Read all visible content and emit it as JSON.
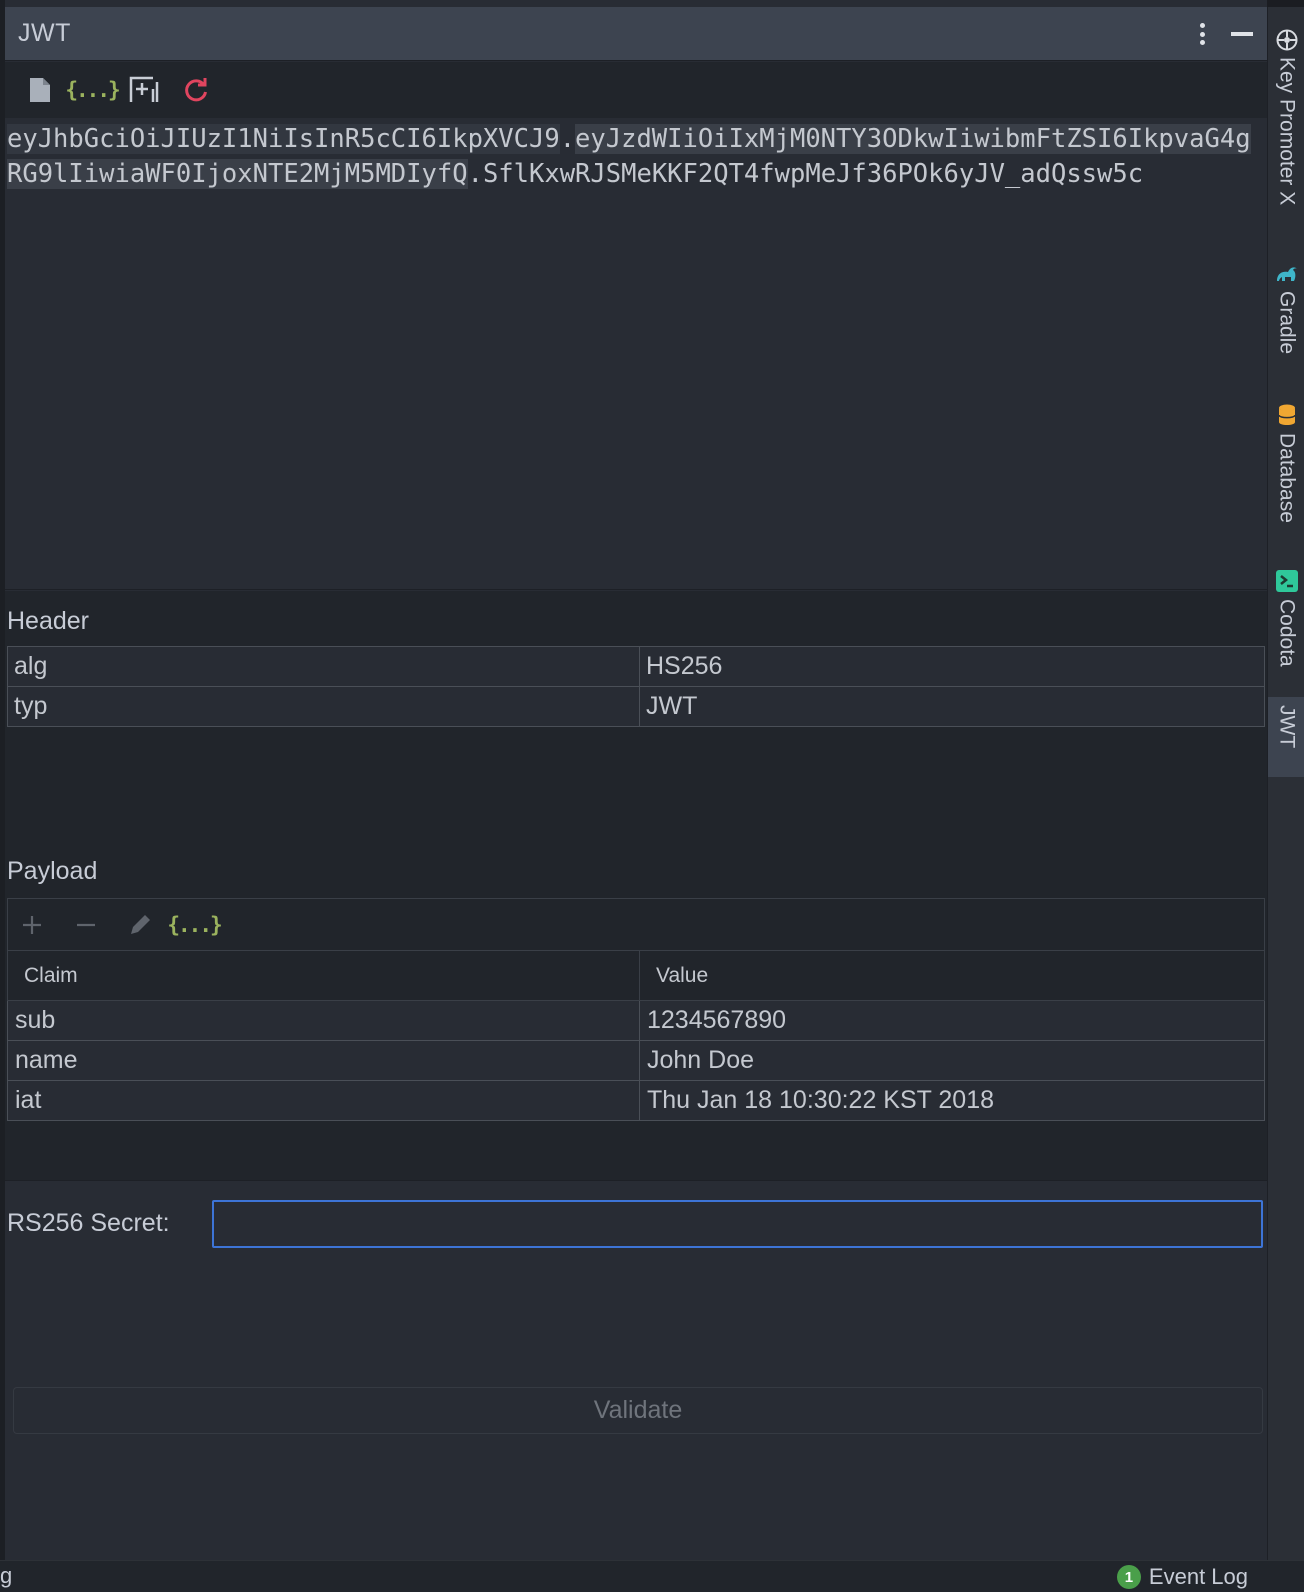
{
  "window": {
    "title": "JWT"
  },
  "token": {
    "header_part": "eyJhbGciOiJIUzI1NiIsInR5cCI6IkpXVCJ9",
    "separator": ".",
    "payload_part": "eyJzdWIiOiIxMjM0NTY3ODkwIiwibmFtZSI6IkpvaG4gRG9lIiwiaWF0IjoxNTE2MjM5MDIyfQ",
    "signature_part": "SflKxwRJSMeKKF2QT4fwpMeJf36POk6yJV_adQssw5c"
  },
  "header_section": {
    "label": "Header",
    "rows": [
      {
        "key": "alg",
        "value": "HS256"
      },
      {
        "key": "typ",
        "value": "JWT"
      }
    ]
  },
  "payload_section": {
    "label": "Payload",
    "columns": {
      "claim": "Claim",
      "value": "Value"
    },
    "rows": [
      {
        "key": "sub",
        "value": "1234567890"
      },
      {
        "key": "name",
        "value": "John Doe"
      },
      {
        "key": "iat",
        "value": "Thu Jan 18 10:30:22 KST 2018"
      }
    ],
    "toolbar_icons": [
      "add-icon",
      "remove-icon",
      "edit-icon",
      "json-braces-icon"
    ]
  },
  "secret": {
    "label": "RS256 Secret:",
    "value": "",
    "placeholder": ""
  },
  "validate_button": {
    "label": "Validate"
  },
  "toolbar": {
    "icons": [
      "file-icon",
      "json-braces-icon",
      "add-frame-icon",
      "refresh-icon"
    ],
    "braces_glyph": "{...}"
  },
  "side_tabs": [
    {
      "label": "Key Promoter X",
      "icon": "key-promoter-icon"
    },
    {
      "label": "Gradle",
      "icon": "gradle-icon"
    },
    {
      "label": "Database",
      "icon": "database-icon"
    },
    {
      "label": "Codota",
      "icon": "codota-icon"
    },
    {
      "label": "JWT",
      "icon": "",
      "active": true
    }
  ],
  "status_bar": {
    "left_fragment": "g",
    "event_count": "1",
    "event_log_label": "Event Log"
  },
  "colors": {
    "accent": "#3d74d6",
    "refresh": "#e0455f",
    "braces": "#9bb35e",
    "gradle": "#3fb5c9",
    "database": "#f0a732",
    "codota": "#2fc89a",
    "event_badge": "#4a9f4a"
  }
}
